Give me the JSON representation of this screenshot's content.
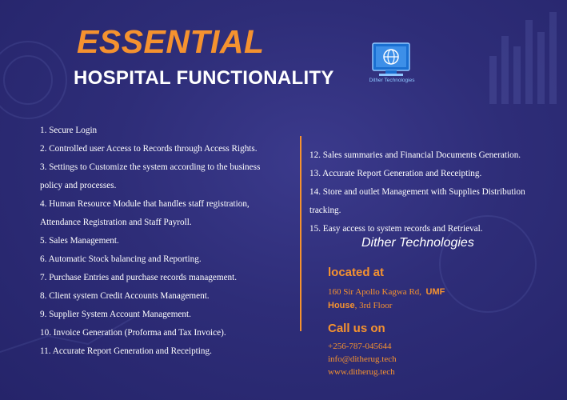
{
  "header": {
    "title": "ESSENTIAL",
    "subtitle": "HOSPITAL FUNCTIONALITY"
  },
  "logo": {
    "icon": "computer-globe-icon",
    "caption": "Dither Technologies"
  },
  "features_left": [
    "1.  Secure Login",
    "2.  Controlled user Access to Records through Access Rights.",
    "3.  Settings to Customize the system according to the business",
    "policy and processes.",
    "4.  Human Resource Module that handles staff registration,",
    "Attendance Registration and Staff Payroll.",
    "5.  Sales Management.",
    "6.  Automatic Stock balancing and Reporting.",
    "7.  Purchase Entries and purchase records management.",
    "8.  Client system Credit Accounts Management.",
    "9.  Supplier System Account Management.",
    "10.  Invoice Generation (Proforma and Tax Invoice).",
    "11.  Accurate Report Generation and Receipting."
  ],
  "features_right": [
    "12.  Sales summaries and Financial Documents Generation.",
    "13. Accurate Report Generation and Receipting.",
    "14. Store and outlet Management with Supplies Distribution",
    "tracking.",
    "15. Easy access to system records and Retrieval."
  ],
  "company": "Dither Technologies",
  "location": {
    "heading": "located at",
    "address_line1_start": "160 Sir Apollo Kagwa Rd,",
    "address_line1_bold": "UMF",
    "address_line2_bold": "House",
    "address_line2_end": ", 3rd Floor"
  },
  "contact": {
    "heading": "Call us on",
    "phone": "+256-787-045644",
    "email": "info@ditherug.tech",
    "website": "www.ditherug.tech"
  },
  "colors": {
    "background": "#2e2d78",
    "accent": "#f5922f",
    "text": "#ffffff"
  }
}
